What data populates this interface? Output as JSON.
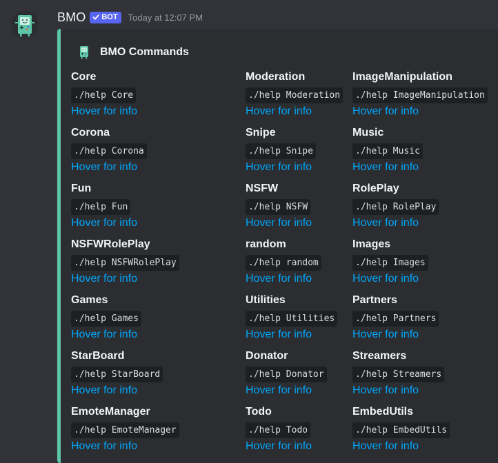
{
  "message": {
    "username": "BMO",
    "bot_badge": "BOT",
    "timestamp": "Today at 12:07 PM",
    "avatar_icon": "bmo-avatar-icon"
  },
  "embed": {
    "accent_color": "#5cc6a6",
    "author_name": "BMO Commands",
    "link_color": "#00a8fc",
    "fields": [
      {
        "name": "Core",
        "code": "./help Core",
        "link": "Hover for info"
      },
      {
        "name": "Moderation",
        "code": "./help Moderation",
        "link": "Hover for info"
      },
      {
        "name": "ImageManipulation",
        "code": "./help ImageManipulation",
        "link": "Hover for info"
      },
      {
        "name": "Corona",
        "code": "./help Corona",
        "link": "Hover for info"
      },
      {
        "name": "Snipe",
        "code": "./help Snipe",
        "link": "Hover for info"
      },
      {
        "name": "Music",
        "code": "./help Music",
        "link": "Hover for info"
      },
      {
        "name": "Fun",
        "code": "./help Fun",
        "link": "Hover for info"
      },
      {
        "name": "NSFW",
        "code": "./help NSFW",
        "link": "Hover for info"
      },
      {
        "name": "RolePlay",
        "code": "./help RolePlay",
        "link": "Hover for info"
      },
      {
        "name": "NSFWRolePlay",
        "code": "./help NSFWRolePlay",
        "link": "Hover for info"
      },
      {
        "name": "random",
        "code": "./help random",
        "link": "Hover for info"
      },
      {
        "name": "Images",
        "code": "./help Images",
        "link": "Hover for info"
      },
      {
        "name": "Games",
        "code": "./help Games",
        "link": "Hover for info"
      },
      {
        "name": "Utilities",
        "code": "./help Utilities",
        "link": "Hover for info"
      },
      {
        "name": "Partners",
        "code": "./help Partners",
        "link": "Hover for info"
      },
      {
        "name": "StarBoard",
        "code": "./help StarBoard",
        "link": "Hover for info"
      },
      {
        "name": "Donator",
        "code": "./help Donator",
        "link": "Hover for info"
      },
      {
        "name": "Streamers",
        "code": "./help Streamers",
        "link": "Hover for info"
      },
      {
        "name": "EmoteManager",
        "code": "./help EmoteManager",
        "link": "Hover for info"
      },
      {
        "name": "Todo",
        "code": "./help Todo",
        "link": "Hover for info"
      },
      {
        "name": "EmbedUtils",
        "code": "./help EmbedUtils",
        "link": "Hover for info"
      }
    ]
  }
}
